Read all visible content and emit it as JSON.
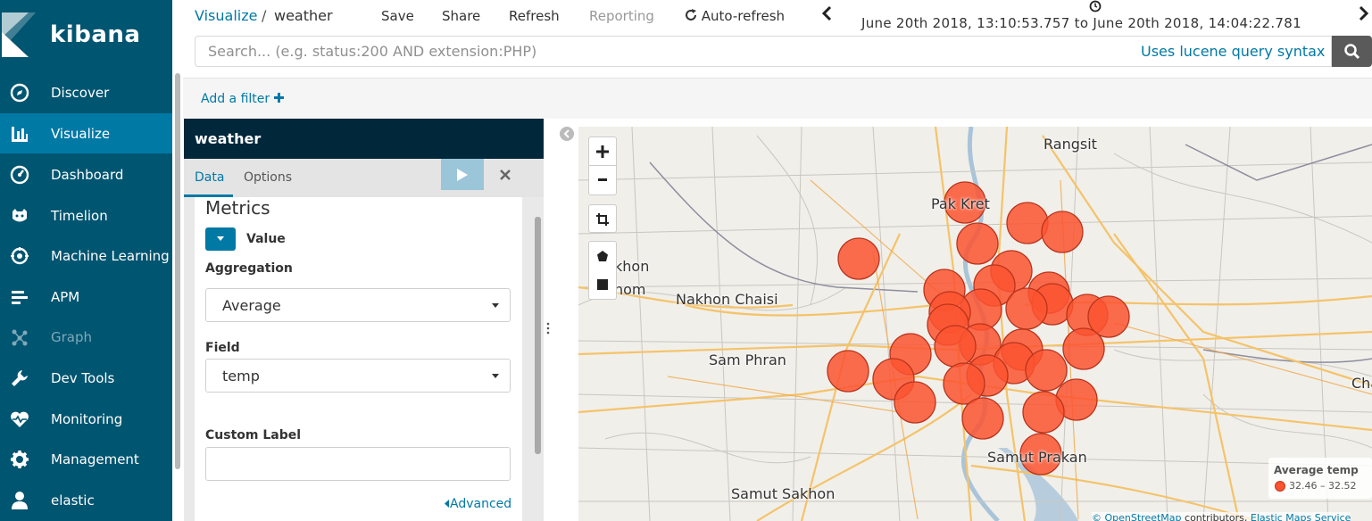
{
  "sidebar": {
    "logo": "kibana",
    "items": [
      {
        "label": "Discover",
        "icon": "compass-icon"
      },
      {
        "label": "Visualize",
        "icon": "bar-chart-icon"
      },
      {
        "label": "Dashboard",
        "icon": "dashboard-icon"
      },
      {
        "label": "Timelion",
        "icon": "timelion-icon"
      },
      {
        "label": "Machine Learning",
        "icon": "machine-learning-icon"
      },
      {
        "label": "APM",
        "icon": "apm-icon"
      },
      {
        "label": "Graph",
        "icon": "graph-icon"
      },
      {
        "label": "Dev Tools",
        "icon": "wrench-icon"
      },
      {
        "label": "Monitoring",
        "icon": "heartbeat-icon"
      },
      {
        "label": "Management",
        "icon": "gear-icon"
      },
      {
        "label": "elastic",
        "icon": "user-icon"
      }
    ],
    "active": "Visualize",
    "disabled": "Graph",
    "colors": {
      "bg": "#005571",
      "active": "#0079a5"
    }
  },
  "header": {
    "breadcrumb_root": "Visualize",
    "breadcrumb_sep": "/",
    "breadcrumb_current": "weather",
    "save": "Save",
    "share": "Share",
    "refresh": "Refresh",
    "reporting": "Reporting",
    "auto_refresh": "Auto-refresh",
    "time_from": "June 20th 2018, 13:10:53.757",
    "time_to_word": "to",
    "time_to": "June 20th 2018, 14:04:22.781"
  },
  "search": {
    "placeholder": "Search... (e.g. status:200 AND extension:PHP)",
    "syntax_link": "Uses lucene query syntax"
  },
  "filters": {
    "add_label": "Add a filter"
  },
  "editor": {
    "title": "weather",
    "tabs": [
      "Data",
      "Options"
    ],
    "active_tab": "Data",
    "section_title": "Metrics",
    "metric_label": "Value",
    "aggregation_label": "Aggregation",
    "aggregation_value": "Average",
    "field_label": "Field",
    "field_value": "temp",
    "custom_label_label": "Custom Label",
    "custom_label_value": "",
    "advanced": "Advanced"
  },
  "map": {
    "places": [
      "Rangsit",
      "Pak Kret",
      "Nakhon Chaisi",
      "Sam Phran",
      "Samut Prakan",
      "Samut Sakhon",
      "khon",
      "hom",
      "Cha"
    ],
    "legend_title": "Average temp",
    "legend_range": "32.46 – 32.52",
    "marker_color": "#fc5430",
    "attribution_a": "© OpenStreetMap",
    "attribution_b": "contributors,",
    "attribution_c": "Elastic Maps Service"
  }
}
